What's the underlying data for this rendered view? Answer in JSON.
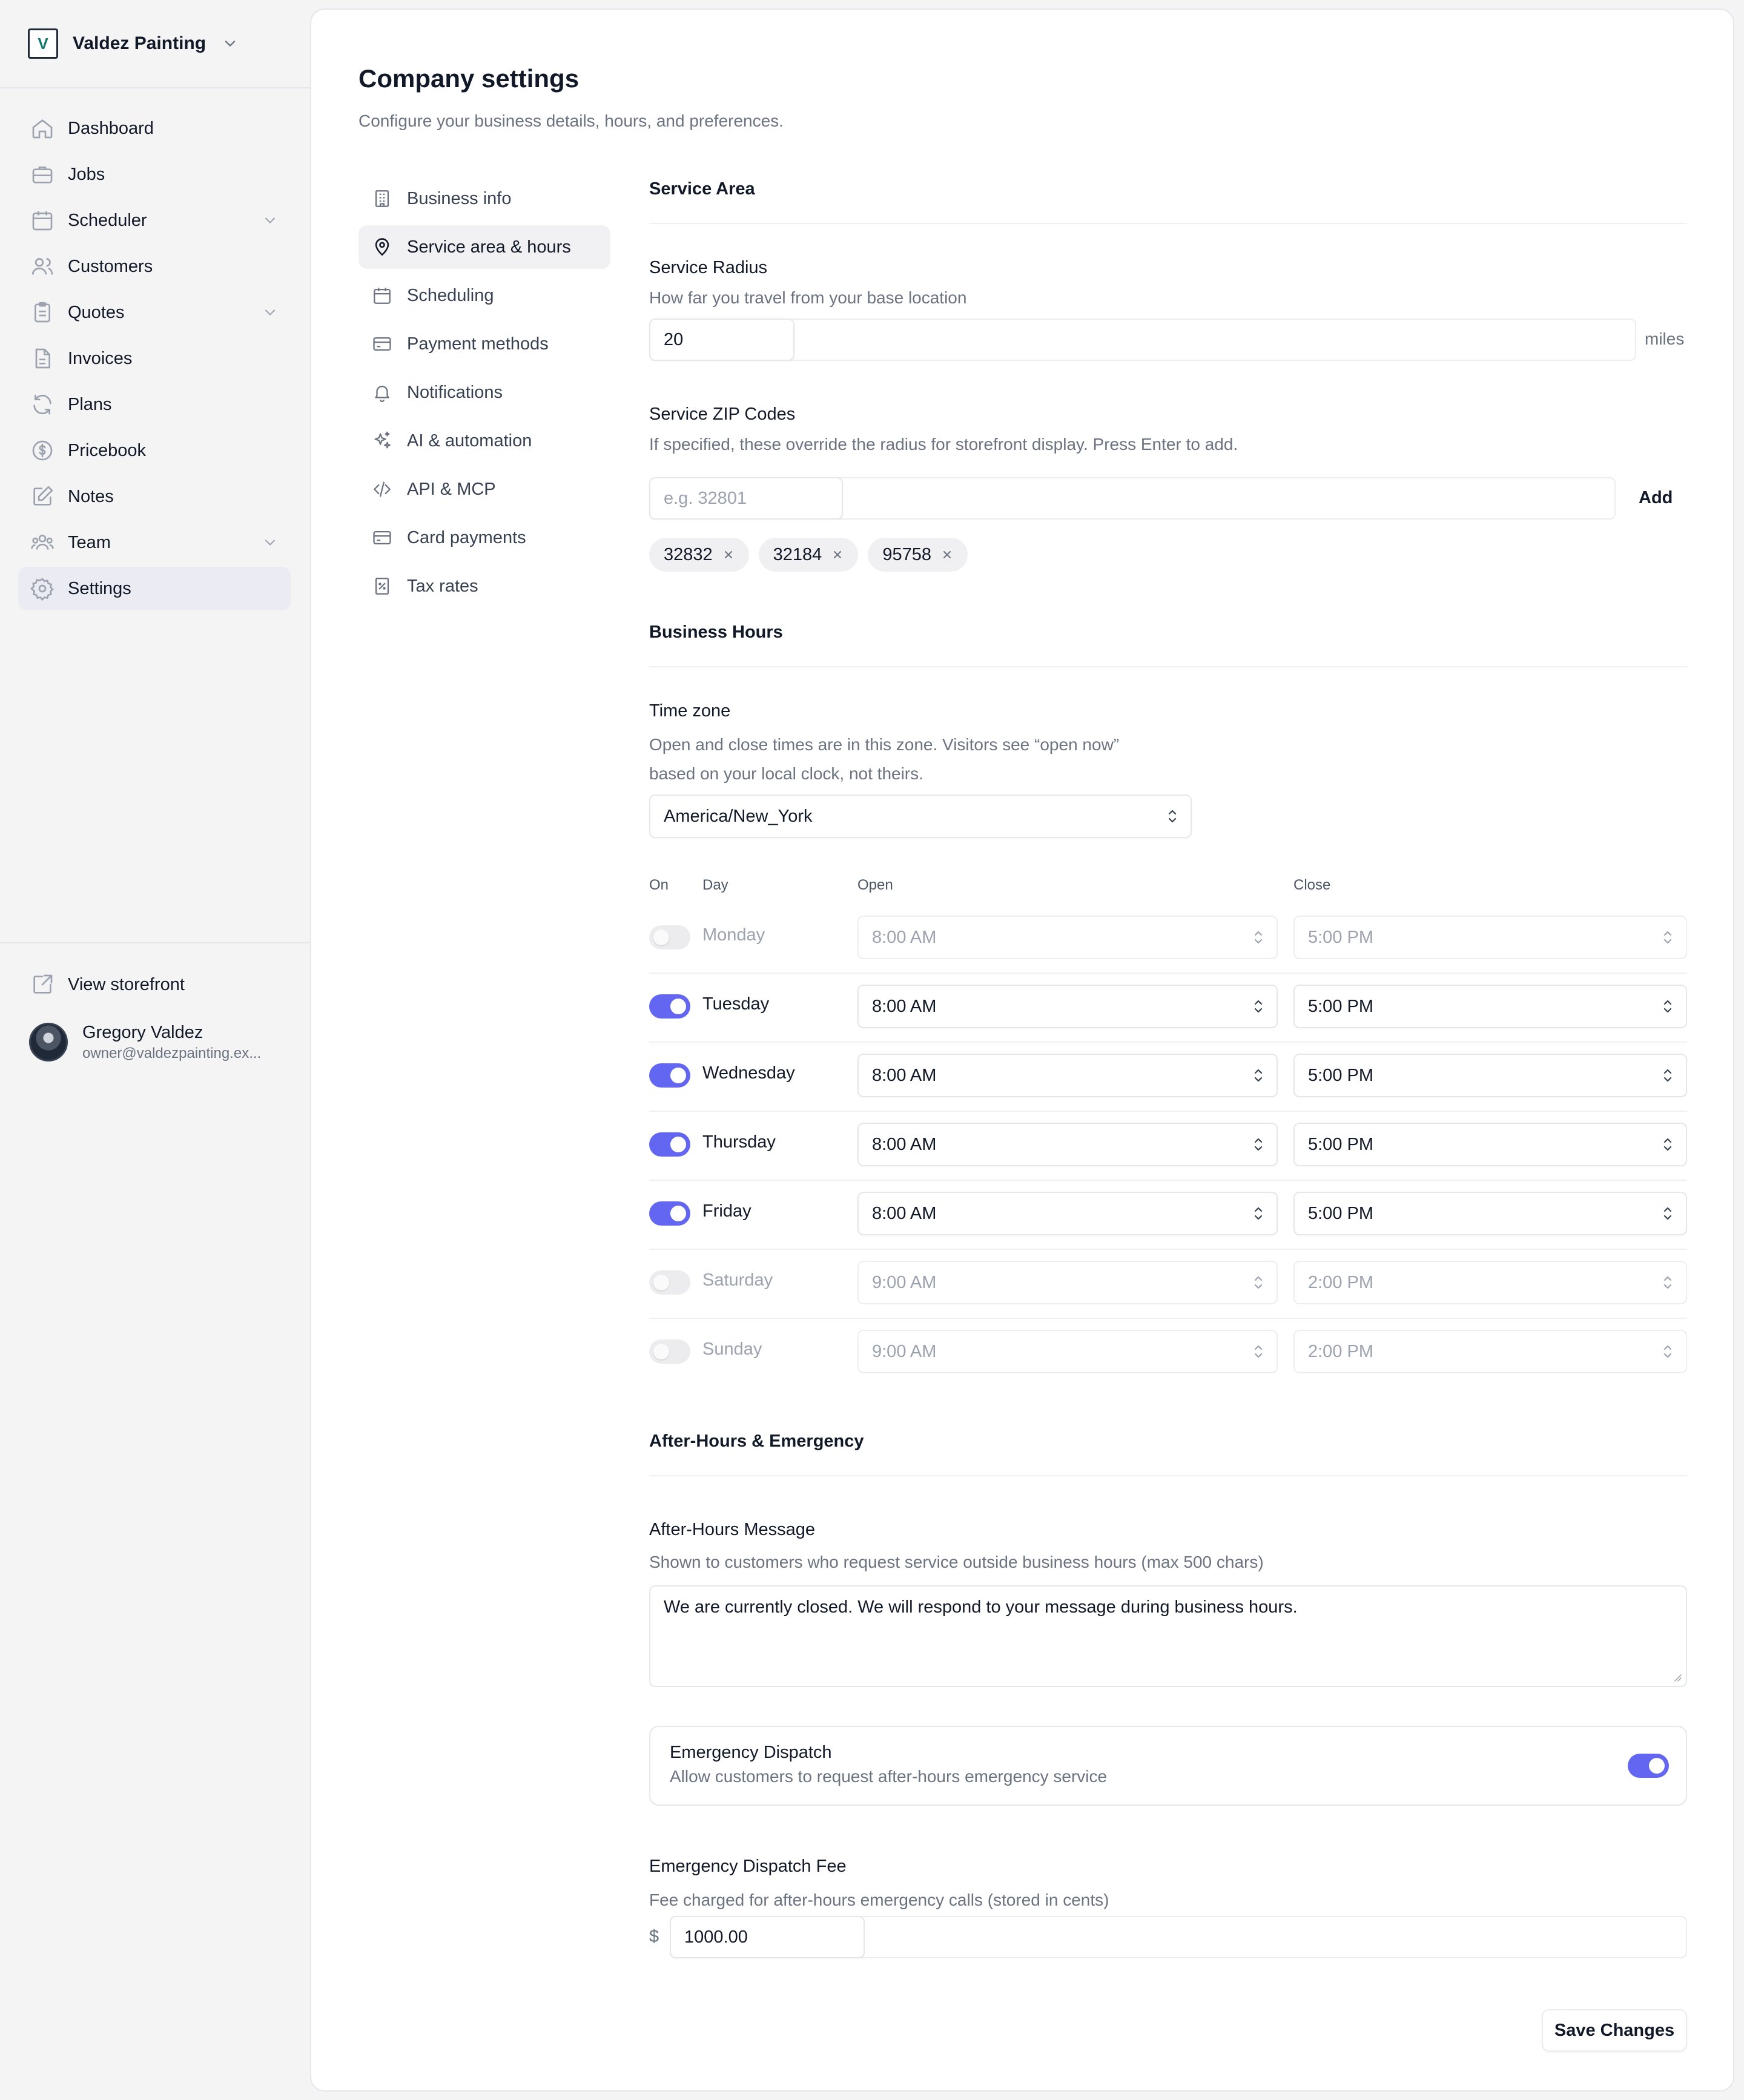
{
  "brand": {
    "name": "Valdez Painting",
    "logo_letter": "V"
  },
  "sidebar": {
    "items": [
      {
        "label": "Dashboard",
        "icon": "home-icon"
      },
      {
        "label": "Jobs",
        "icon": "briefcase-icon"
      },
      {
        "label": "Scheduler",
        "icon": "calendar-icon",
        "expandable": true
      },
      {
        "label": "Customers",
        "icon": "users-icon"
      },
      {
        "label": "Quotes",
        "icon": "clipboard-icon",
        "expandable": true
      },
      {
        "label": "Invoices",
        "icon": "file-icon"
      },
      {
        "label": "Plans",
        "icon": "refresh-icon"
      },
      {
        "label": "Pricebook",
        "icon": "dollar-icon"
      },
      {
        "label": "Notes",
        "icon": "pencil-icon"
      },
      {
        "label": "Team",
        "icon": "team-icon",
        "expandable": true
      },
      {
        "label": "Settings",
        "icon": "gear-icon",
        "active": true
      }
    ],
    "view_storefront": "View storefront",
    "user": {
      "name": "Gregory Valdez",
      "email": "owner@valdezpainting.ex..."
    }
  },
  "page": {
    "title": "Company settings",
    "subtitle": "Configure your business details, hours, and preferences."
  },
  "subnav": [
    {
      "label": "Business info",
      "icon": "building-icon"
    },
    {
      "label": "Service area & hours",
      "icon": "map-pin-icon",
      "active": true
    },
    {
      "label": "Scheduling",
      "icon": "calendar-icon"
    },
    {
      "label": "Payment methods",
      "icon": "credit-card-icon"
    },
    {
      "label": "Notifications",
      "icon": "bell-icon"
    },
    {
      "label": "AI & automation",
      "icon": "sparkles-icon"
    },
    {
      "label": "API & MCP",
      "icon": "code-icon"
    },
    {
      "label": "Card payments",
      "icon": "credit-card-icon"
    },
    {
      "label": "Tax rates",
      "icon": "receipt-icon"
    }
  ],
  "service_area": {
    "title": "Service Area",
    "radius_label": "Service Radius",
    "radius_help": "How far you travel from your base location",
    "radius_value": "20",
    "radius_unit": "miles",
    "zip_label": "Service ZIP Codes",
    "zip_help": "If specified, these override the radius for storefront display. Press Enter to add.",
    "zip_placeholder": "e.g. 32801",
    "add_label": "Add",
    "zips": [
      "32832",
      "32184",
      "95758"
    ]
  },
  "hours": {
    "title": "Business Hours",
    "tz_label": "Time zone",
    "tz_help_1": "Open and close times are in this zone. Visitors see “open now”",
    "tz_help_2": "based on your local clock, not theirs.",
    "tz_value": "America/New_York",
    "col_on": "On",
    "col_day": "Day",
    "col_open": "Open",
    "col_close": "Close",
    "days": [
      {
        "day": "Monday",
        "on": false,
        "open": "8:00 AM",
        "close": "5:00 PM"
      },
      {
        "day": "Tuesday",
        "on": true,
        "open": "8:00 AM",
        "close": "5:00 PM"
      },
      {
        "day": "Wednesday",
        "on": true,
        "open": "8:00 AM",
        "close": "5:00 PM"
      },
      {
        "day": "Thursday",
        "on": true,
        "open": "8:00 AM",
        "close": "5:00 PM"
      },
      {
        "day": "Friday",
        "on": true,
        "open": "8:00 AM",
        "close": "5:00 PM"
      },
      {
        "day": "Saturday",
        "on": false,
        "open": "9:00 AM",
        "close": "2:00 PM"
      },
      {
        "day": "Sunday",
        "on": false,
        "open": "9:00 AM",
        "close": "2:00 PM"
      }
    ]
  },
  "after_hours": {
    "title": "After-Hours & Emergency",
    "message_label": "After-Hours Message",
    "message_help": "Shown to customers who request service outside business hours (max 500 chars)",
    "message_value": "We are currently closed. We will respond to your message during business hours.",
    "dispatch_title": "Emergency Dispatch",
    "dispatch_sub": "Allow customers to request after-hours emergency service",
    "dispatch_on": true,
    "fee_label": "Emergency Dispatch Fee",
    "fee_help": "Fee charged for after-hours emergency calls (stored in cents)",
    "currency": "$",
    "fee_value": "1000.00"
  },
  "save_label": "Save Changes",
  "colors": {
    "accent": "#6366f1",
    "active_nav": "#ebebf3"
  }
}
